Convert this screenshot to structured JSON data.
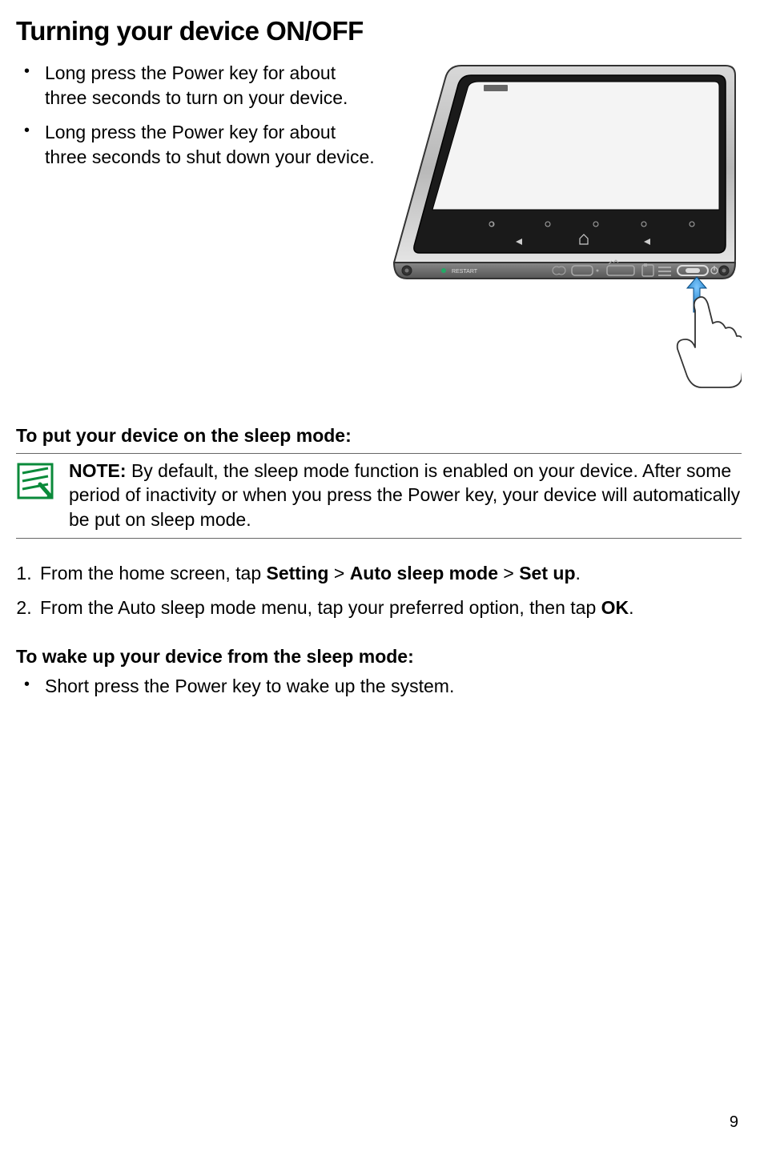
{
  "title": "Turning your device ON/OFF",
  "topBullets": [
    "Long press the Power key for about three seconds to turn on your device.",
    "Long press the Power key for about three seconds to shut down your device."
  ],
  "section1": {
    "heading": "To put your device on the sleep mode:",
    "note": {
      "label": "NOTE:",
      "body": " By default, the sleep mode function is enabled on your device. After some period of inactivity or when you press the Power key, your device will automatically be put on sleep mode."
    },
    "step1": {
      "prefix": "From the home screen, tap ",
      "b1": "Setting",
      "sep1": " > ",
      "b2": "Auto sleep mode",
      "sep2": " > ",
      "b3": "Set up",
      "suffix": "."
    },
    "step2": {
      "prefix": "From the Auto sleep mode menu, tap your preferred option, then tap ",
      "b1": "OK",
      "suffix": "."
    }
  },
  "section2": {
    "heading": "To wake up your device from the sleep mode:",
    "bullets": [
      "Short press the Power key to wake up the system."
    ]
  },
  "deviceLabel": "RESTART",
  "pageNumber": "9"
}
